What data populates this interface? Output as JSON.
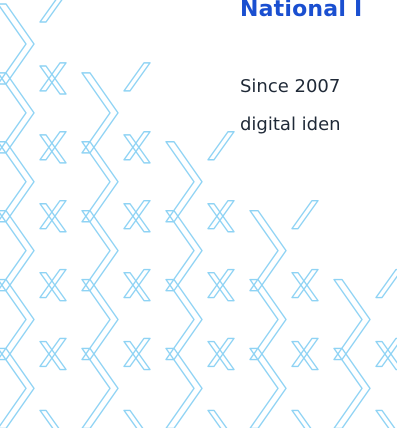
{
  "section": {
    "heading": "National I",
    "body_lines": [
      "Since 2007",
      "digital iden"
    ]
  },
  "decoration": {
    "pattern_icon": "chevron-x-icon",
    "stroke_color": "#8fd3f4"
  }
}
